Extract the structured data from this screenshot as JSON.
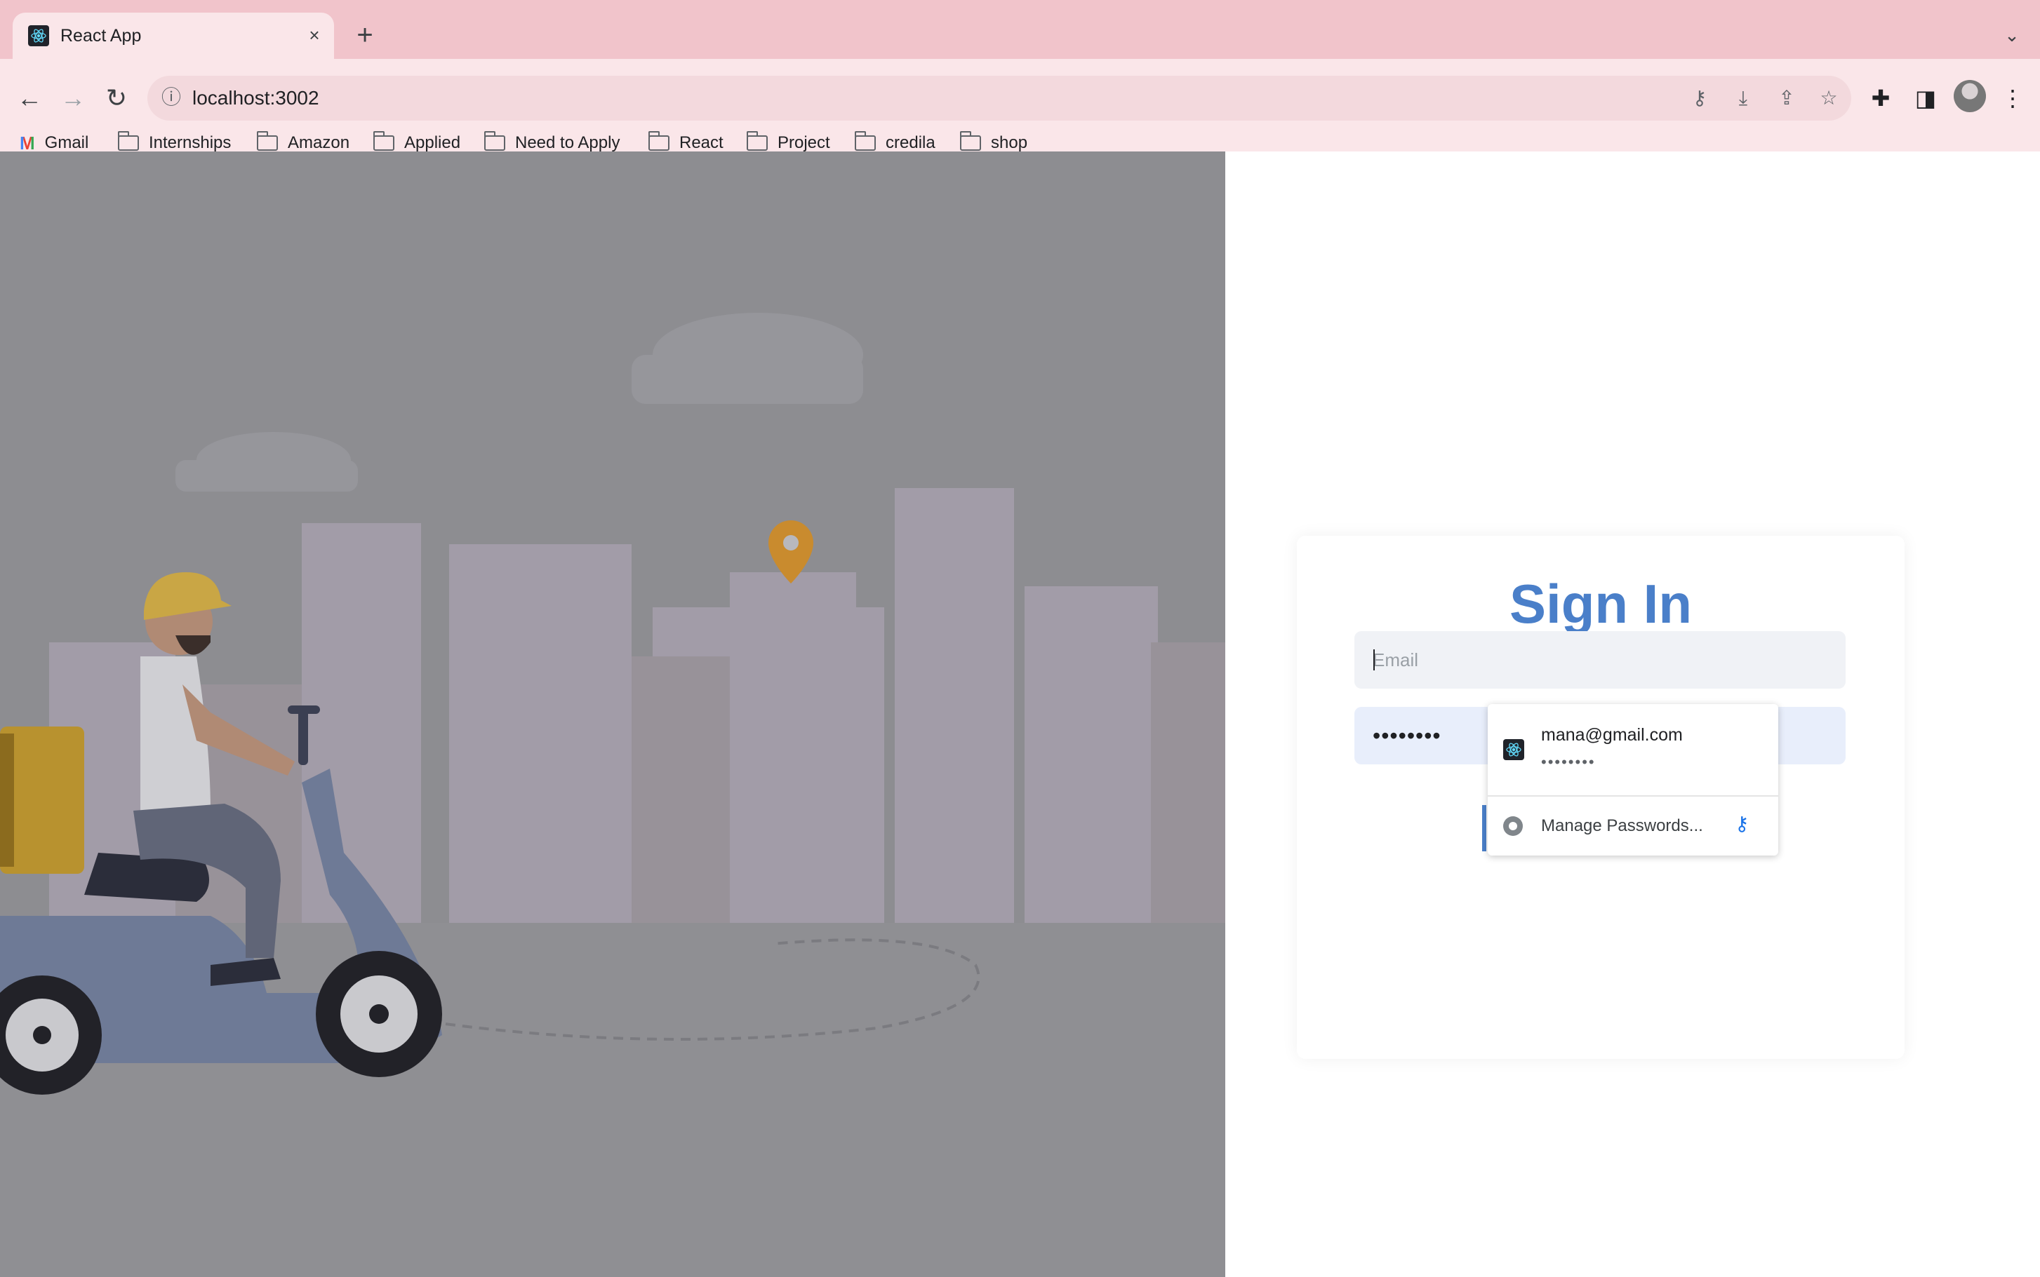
{
  "browser": {
    "tab_title": "React App",
    "tab_close": "×",
    "new_tab": "+",
    "tab_list": "⌄",
    "url": "localhost:3002",
    "bookmarks": [
      "Gmail",
      "Internships",
      "Amazon",
      "Applied",
      "Need to Apply",
      "React",
      "Project",
      "credila",
      "shop"
    ]
  },
  "signin": {
    "title": "Sign In",
    "email_placeholder": "Email",
    "password_value": "••••••••"
  },
  "autofill": {
    "saved_email": "mana@gmail.com",
    "saved_password_mask": "••••••••",
    "manage_label": "Manage Passwords..."
  },
  "colors": {
    "accent": "#4a7fc9",
    "tabstrip": "#f1c4cb",
    "overlay": "#8d8d91"
  }
}
